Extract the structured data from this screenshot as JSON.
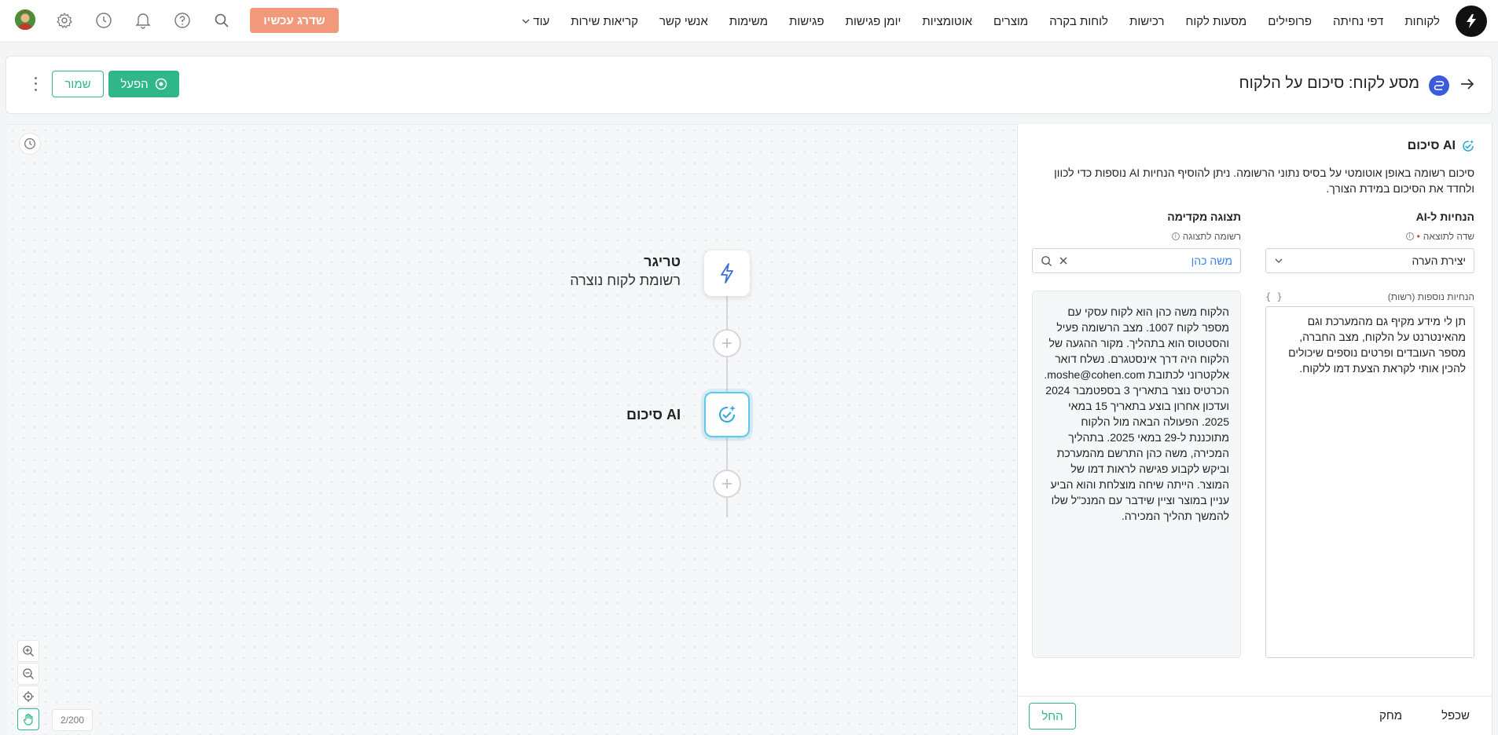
{
  "nav": {
    "items": [
      "לקוחות",
      "דפי נחיתה",
      "פרופילים",
      "מסעות לקוח",
      "רכישות",
      "לוחות בקרה",
      "מוצרים",
      "אוטומציות",
      "יומן פגישות",
      "פגישות",
      "משימות",
      "אנשי קשר",
      "קריאות שירות"
    ],
    "more_label": "עוד",
    "upgrade_label": "שדרג עכשיו"
  },
  "header": {
    "title": "מסע לקוח: סיכום על הלקוח",
    "activate_label": "הפעל",
    "save_label": "שמור"
  },
  "canvas": {
    "trigger_title": "טריגר",
    "trigger_subtitle": "רשומת לקוח נוצרה",
    "ai_node_title": "AI סיכום",
    "counter": "2/200"
  },
  "panel": {
    "title": "AI סיכום",
    "description": "סיכום רשומה באופן אוטומטי על בסיס נתוני הרשומה. ניתן להוסיף הנחיות AI נוספות כדי לכוון ולחדד את הסיכום במידת הצורך.",
    "instructions_heading": "הנחיות ל-AI",
    "preview_heading": "תצוגה מקדימה",
    "result_field_label": "שדה לתוצאה",
    "result_field_value": "יצירת הערה",
    "preview_record_label": "רשומה לתצוגה",
    "preview_record_value": "משה כהן",
    "optional_label": "הנחיות נוספות (רשות)",
    "optional_braces": "{ }",
    "instructions_text": "תן לי מידע מקיף גם מהמערכת וגם מהאינטרנט על הלקוח, מצב החברה, מספר העובדים ופרטים נוספים שיכולים להכין אותי לקראת הצעת דמו ללקוח.",
    "preview_text": "הלקוח משה כהן הוא לקוח עסקי עם מספר לקוח 1007. מצב הרשומה פעיל והסטטוס הוא בתהליך. מקור ההגעה של הלקוח היה דרך אינסטגרם. נשלח דואר אלקטרוני לכתובת moshe@cohen.com. הכרטיס נוצר בתאריך 3 בספטמבר 2024 ועדכון אחרון בוצע בתאריך 15 במאי 2025. הפעולה הבאה מול הלקוח מתוכננת ל-29 במאי 2025. בתהליך המכירה, משה כהן התרשם מהמערכת וביקש לקבוע פגישה לראות דמו של המוצר. הייתה שיחה מוצלחת והוא הביע עניין במוצר וציין שידבר עם המנכ\"ל שלו להמשך תהליך המכירה.",
    "footer": {
      "duplicate_label": "שכפל",
      "delete_label": "מחק",
      "run_label": "החל"
    }
  },
  "colors": {
    "accent": "#2fb789",
    "upgrade": "#f2997b",
    "ai_node_border": "#5ec8ee"
  }
}
